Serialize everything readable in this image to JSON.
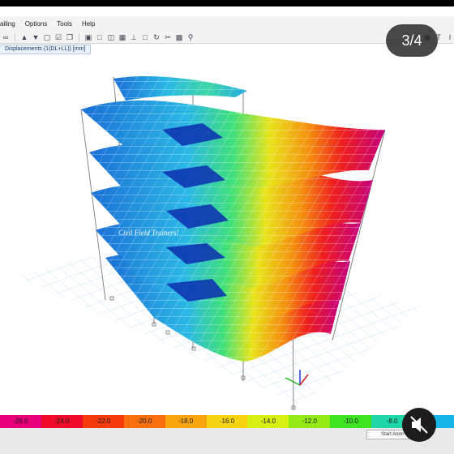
{
  "menu": {
    "items": [
      "ailing",
      "Options",
      "Tools",
      "Help"
    ]
  },
  "toolbar": {
    "icons": [
      "binoculars-icon",
      "arrow-up-icon",
      "arrow-down-icon",
      "select-icon",
      "checkbox-icon",
      "copy-icon",
      "view-icon",
      "window-icon",
      "elevation-icon",
      "plan-icon",
      "frame-icon",
      "section-icon",
      "rotate-icon",
      "section-icon-2",
      "cut-icon",
      "cube-icon",
      "zoom-icon"
    ],
    "right_icons": [
      "beam-i-icon",
      "box-icon",
      "t-section-icon",
      "column-icon"
    ]
  },
  "tab": {
    "label": "Displacements (1(DL+LL)) [mm]"
  },
  "pager": {
    "text": "3/4"
  },
  "viewport": {
    "watermark": "Civil Field Trainers!"
  },
  "legend": {
    "stops": [
      {
        "label": "-26.0",
        "color": "#e8007a"
      },
      {
        "label": "-24.0",
        "color": "#ee0c2a"
      },
      {
        "label": "-22.0",
        "color": "#f53a0e"
      },
      {
        "label": "-20.0",
        "color": "#f7700d"
      },
      {
        "label": "-18.0",
        "color": "#f9a50f"
      },
      {
        "label": "-16.0",
        "color": "#f6d412"
      },
      {
        "label": "-14.0",
        "color": "#d8ef13"
      },
      {
        "label": "-12.0",
        "color": "#93ea15"
      },
      {
        "label": "-10.0",
        "color": "#3ee322"
      },
      {
        "label": "-8.0",
        "color": "#1ed6a8"
      },
      {
        "label": "",
        "color": "#18b6e8"
      }
    ]
  },
  "statusbar": {
    "start_button": "Start Anim"
  }
}
